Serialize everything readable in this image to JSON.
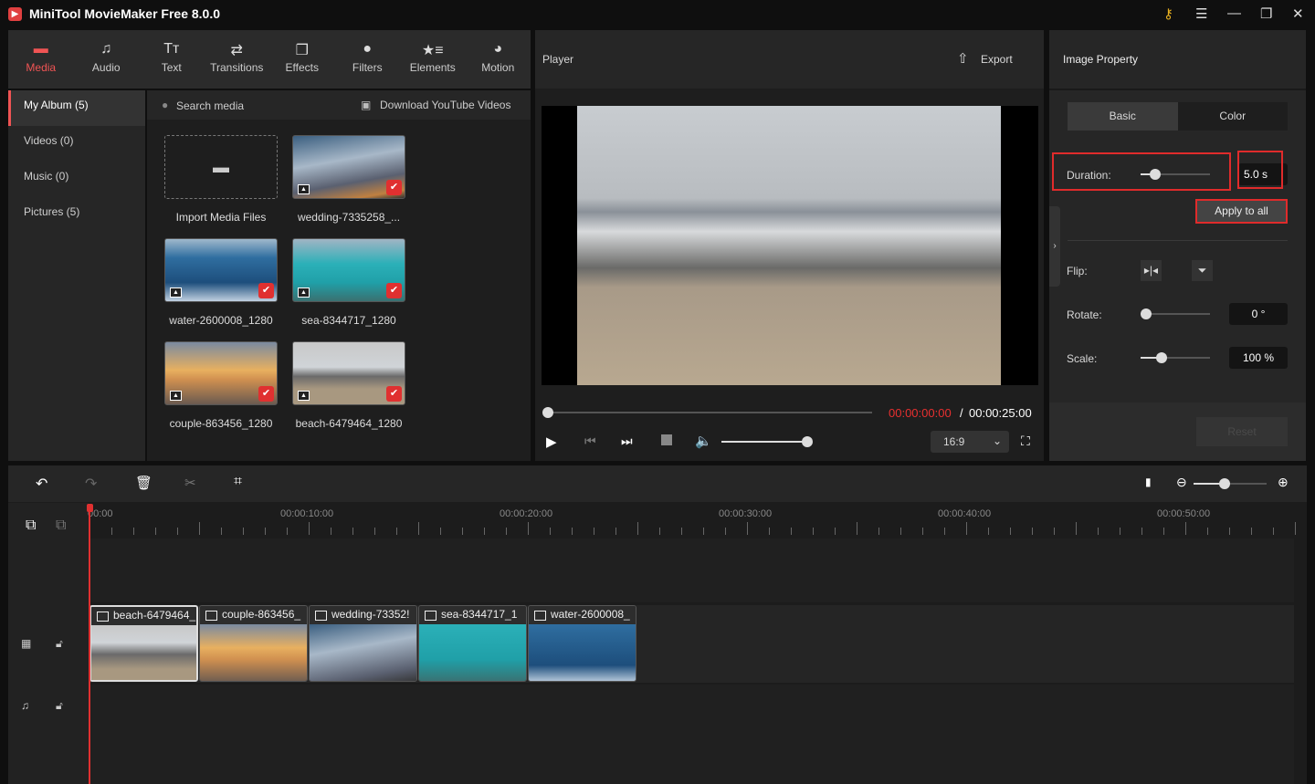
{
  "app": {
    "title": "MiniTool MovieMaker Free 8.0.0"
  },
  "tabs": [
    {
      "label": "Media",
      "icon": "folder-icon"
    },
    {
      "label": "Audio",
      "icon": "music-icon"
    },
    {
      "label": "Text",
      "icon": "text-icon"
    },
    {
      "label": "Transitions",
      "icon": "swap-icon"
    },
    {
      "label": "Effects",
      "icon": "effects-icon"
    },
    {
      "label": "Filters",
      "icon": "filters-icon"
    },
    {
      "label": "Elements",
      "icon": "elements-icon"
    },
    {
      "label": "Motion",
      "icon": "motion-icon"
    }
  ],
  "sidebar": [
    {
      "label": "My Album (5)"
    },
    {
      "label": "Videos (0)"
    },
    {
      "label": "Music (0)"
    },
    {
      "label": "Pictures (5)"
    }
  ],
  "media": {
    "search_placeholder": "Search media",
    "download": "Download YouTube Videos",
    "items": [
      {
        "name": "Import Media Files"
      },
      {
        "name": "wedding-7335258_..."
      },
      {
        "name": "water-2600008_1280"
      },
      {
        "name": "sea-8344717_1280"
      },
      {
        "name": "couple-863456_1280"
      },
      {
        "name": "beach-6479464_1280"
      }
    ]
  },
  "player": {
    "title": "Player",
    "export": "Export",
    "current_time": "00:00:00:00",
    "separator": " / ",
    "total_time": "00:00:25:00",
    "aspect": "16:9",
    "progress": 0,
    "volume": 1.0
  },
  "property": {
    "title": "Image Property",
    "tabs": [
      "Basic",
      "Color"
    ],
    "active_tab": "Basic",
    "duration_label": "Duration:",
    "duration_value": "5.0 s",
    "apply_all": "Apply to all",
    "flip_label": "Flip:",
    "rotate_label": "Rotate:",
    "rotate_value": "0 °",
    "scale_label": "Scale:",
    "scale_value": "100 %",
    "reset": "Reset",
    "highlight_color": "#e02b2b"
  },
  "timeline": {
    "ruler": [
      "00:00",
      "00:00:10:00",
      "00:00:20:00",
      "00:00:30:00",
      "00:00:40:00",
      "00:00:50:00"
    ],
    "clips": [
      {
        "name": "beach-6479464_"
      },
      {
        "name": "couple-863456_"
      },
      {
        "name": "wedding-73352!"
      },
      {
        "name": "sea-8344717_1"
      },
      {
        "name": "water-2600008_"
      }
    ]
  },
  "accent": "#f05454"
}
